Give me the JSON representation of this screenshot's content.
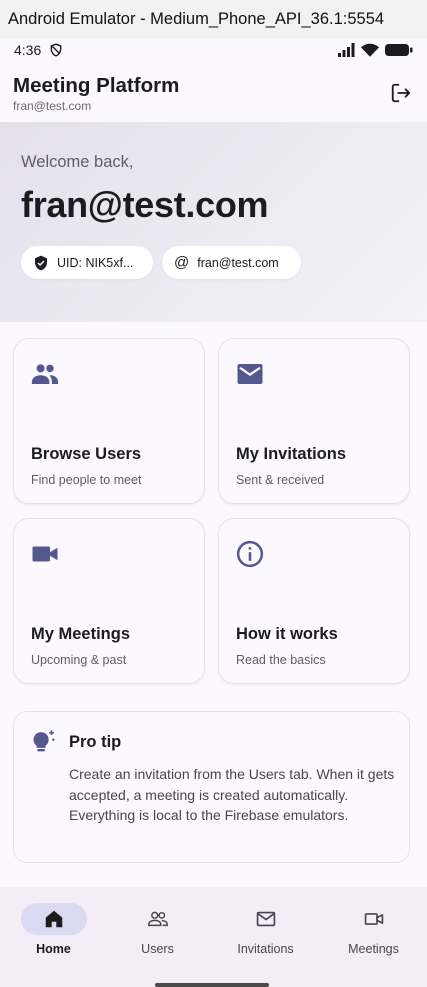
{
  "window": {
    "title": "Android Emulator - Medium_Phone_API_36.1:5554"
  },
  "status_bar": {
    "time": "4:36"
  },
  "app_bar": {
    "title": "Meeting Platform",
    "subtitle": "fran@test.com"
  },
  "hero": {
    "welcome": "Welcome back,",
    "email": "fran@test.com",
    "chips": {
      "uid": "UID: NIK5xf...",
      "email": "fran@test.com"
    }
  },
  "cards": [
    {
      "title": "Browse Users",
      "subtitle": "Find people to meet",
      "icon": "people-icon"
    },
    {
      "title": "My Invitations",
      "subtitle": "Sent & received",
      "icon": "mail-icon"
    },
    {
      "title": "My Meetings",
      "subtitle": "Upcoming & past",
      "icon": "video-camera-icon"
    },
    {
      "title": "How it works",
      "subtitle": "Read the basics",
      "icon": "info-icon"
    }
  ],
  "tip": {
    "title": "Pro tip",
    "body": "Create an invitation from the Users tab. When it gets accepted, a meeting is created automatically. Everything is local to the Firebase emulators."
  },
  "nav": [
    {
      "label": "Home",
      "icon": "home-icon",
      "active": true
    },
    {
      "label": "Users",
      "icon": "users-icon",
      "active": false
    },
    {
      "label": "Invitations",
      "icon": "mail-outline-icon",
      "active": false
    },
    {
      "label": "Meetings",
      "icon": "video-outline-icon",
      "active": false
    }
  ],
  "colors": {
    "accent": "#55588f",
    "nav_active": "#dcdaf3",
    "background": "#fcf8ff"
  }
}
